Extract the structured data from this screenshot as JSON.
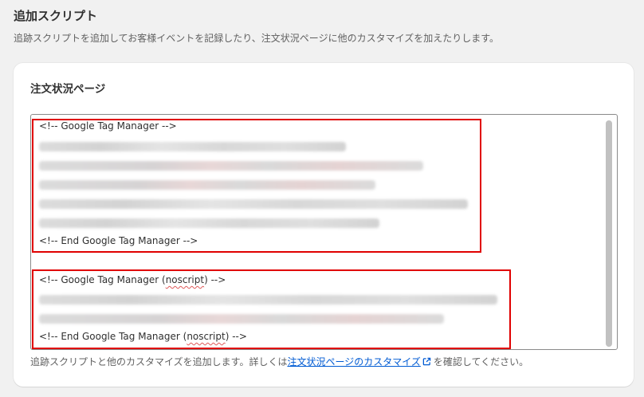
{
  "section": {
    "title": "追加スクリプト",
    "description": "追跡スクリプトを追加してお客様イベントを記録したり、注文状況ページに他のカスタマイズを加えたりします。"
  },
  "card": {
    "title": "注文状況ページ",
    "code": {
      "gtm_start": "<!-- Google Tag Manager -->",
      "gtm_end": "<!-- End Google Tag Manager -->",
      "noscript_start_prefix": "<!-- Google Tag Manager (",
      "noscript_word": "noscript",
      "noscript_start_suffix": ") -->",
      "noscript_end_prefix": "<!-- End Google Tag Manager (",
      "noscript_end_suffix": ") -->"
    },
    "help": {
      "prefix": "追跡スクリプトと他のカスタマイズを追加します。詳しくは",
      "link": "注文状況ページのカスタマイズ",
      "suffix": "を確認してください。"
    }
  },
  "colors": {
    "highlight": "#e00000",
    "link": "#005bd3"
  },
  "icons": {
    "external_link": "external-link-icon"
  }
}
